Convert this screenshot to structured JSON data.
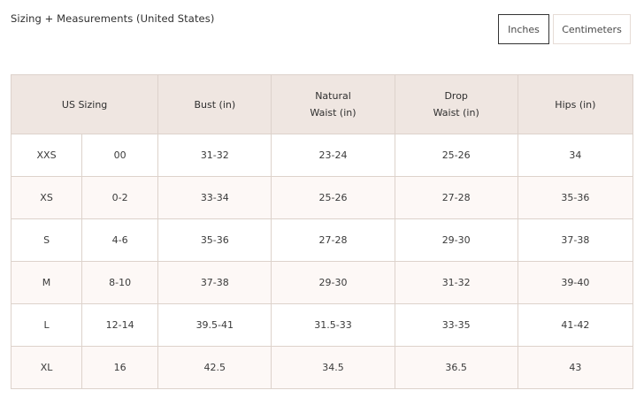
{
  "heading": "Sizing + Measurements (United States)",
  "unit_toggle": {
    "inches_label": "Inches",
    "centimeters_label": "Centimeters",
    "selected": "Inches"
  },
  "table": {
    "headers": {
      "us_sizing": "US Sizing",
      "bust": "Bust (in)",
      "natural_waist_line1": "Natural",
      "natural_waist_line2": "Waist (in)",
      "drop_waist_line1": "Drop",
      "drop_waist_line2": "Waist (in)",
      "hips": "Hips (in)"
    },
    "rows": [
      {
        "size": "XXS",
        "us": "00",
        "bust": "31-32",
        "natural_waist": "23-24",
        "drop_waist": "25-26",
        "hips": "34"
      },
      {
        "size": "XS",
        "us": "0-2",
        "bust": "33-34",
        "natural_waist": "25-26",
        "drop_waist": "27-28",
        "hips": "35-36"
      },
      {
        "size": "S",
        "us": "4-6",
        "bust": "35-36",
        "natural_waist": "27-28",
        "drop_waist": "29-30",
        "hips": "37-38"
      },
      {
        "size": "M",
        "us": "8-10",
        "bust": "37-38",
        "natural_waist": "29-30",
        "drop_waist": "31-32",
        "hips": "39-40"
      },
      {
        "size": "L",
        "us": "12-14",
        "bust": "39.5-41",
        "natural_waist": "31.5-33",
        "drop_waist": "33-35",
        "hips": "41-42"
      },
      {
        "size": "XL",
        "us": "16",
        "bust": "42.5",
        "natural_waist": "34.5",
        "drop_waist": "36.5",
        "hips": "43"
      }
    ]
  }
}
